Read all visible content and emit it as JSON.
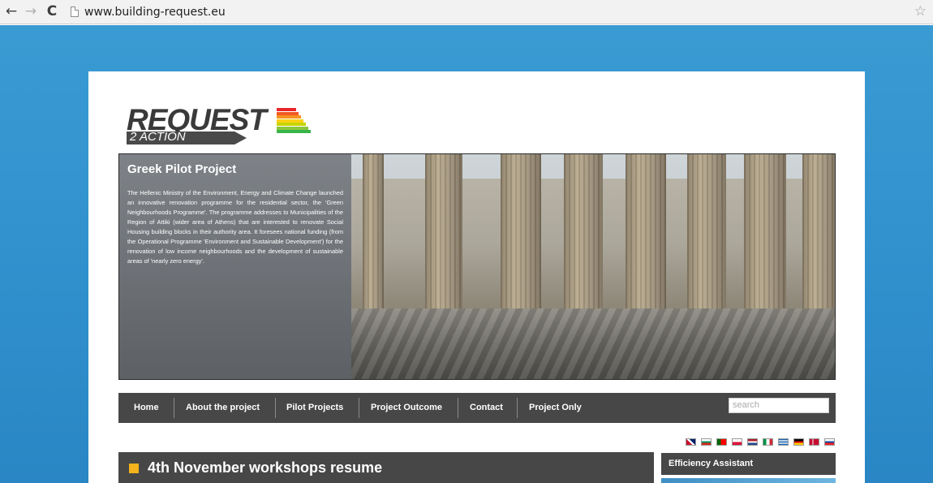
{
  "browser": {
    "url": "www.building-request.eu"
  },
  "logo": {
    "word": "REQUEST",
    "sub": "2 ACTION",
    "bar_colors": [
      "#e8262a",
      "#f15a24",
      "#f7931e",
      "#fcd116",
      "#c8d400",
      "#8cc63f",
      "#39b54a"
    ]
  },
  "hero": {
    "title": "Greek Pilot Project",
    "text": "The Hellenic Ministry of the Environment, Energy and Climate Change launched an innovative renovation programme for the residential sector, the 'Green Neighbourhoods Programme'. The programme addresses to Municipalities of the Region of Attiki (wider area of Athens) that are interested to renovate Social Housing building blocks in their authority area. It foresees national funding (from the Operational Programme 'Environment and Sustainable Development') for the renovation of low income neighbourhoods and the development of sustainable areas of 'nearly zero energy'."
  },
  "nav": {
    "items": [
      {
        "label": "Home"
      },
      {
        "label": "About the project"
      },
      {
        "label": "Pilot Projects"
      },
      {
        "label": "Project Outcome"
      },
      {
        "label": "Contact"
      },
      {
        "label": "Project Only"
      }
    ],
    "search_placeholder": "search"
  },
  "languages": [
    "en",
    "bg",
    "pt",
    "pl",
    "nl",
    "it",
    "gr",
    "de",
    "dk",
    "sk"
  ],
  "news": {
    "title": "4th November workshops resume"
  },
  "sidebar": {
    "title": "Efficiency Assistant"
  },
  "colors": {
    "backdrop": "#2f8fcc",
    "bar": "#474747",
    "accent": "#f5b21c"
  }
}
